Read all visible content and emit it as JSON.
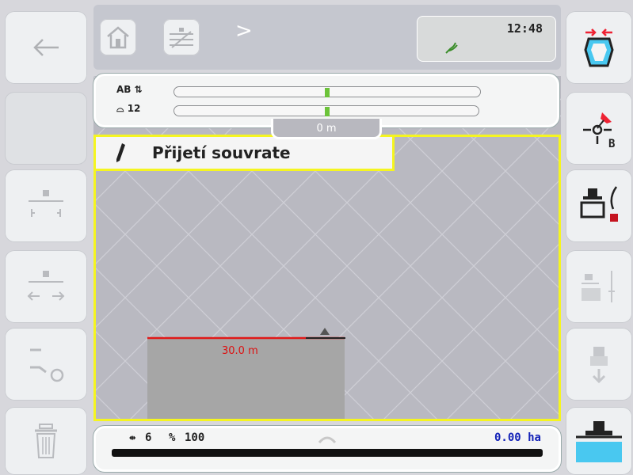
{
  "header": {
    "clock": "12:48",
    "breadcrumb_separator": ">"
  },
  "guidance": {
    "mode_label": "AB",
    "swath_label": "12",
    "distance_label": "0 m",
    "mode_title": "Přijetí souvrate"
  },
  "map": {
    "width_label": "30.0 m"
  },
  "bottom": {
    "width_value": "6",
    "percent_value": "100",
    "area": "0.00 ha"
  },
  "colors": {
    "map_background": "#b9b9c1",
    "highlight": "#f5f520",
    "lightbar_marker": "#6cc33a",
    "boundary_line": "#e01919",
    "area_text": "#1322b8",
    "water": "#49c8f0"
  },
  "icons": {
    "left": [
      "back-arrow-icon",
      "empty-slot",
      "boundary-width-icon",
      "shift-track-icon",
      "reset-track-icon",
      "trash-icon"
    ],
    "right": [
      "collapse-field-icon",
      "set-point-icon",
      "headland-mode-icon",
      "lane-offset-icon",
      "move-vehicle-icon",
      "vehicle-water-icon"
    ],
    "breadcrumb": [
      "home-icon",
      "field-tracks-icon"
    ],
    "status": "gps-signal-icon"
  }
}
